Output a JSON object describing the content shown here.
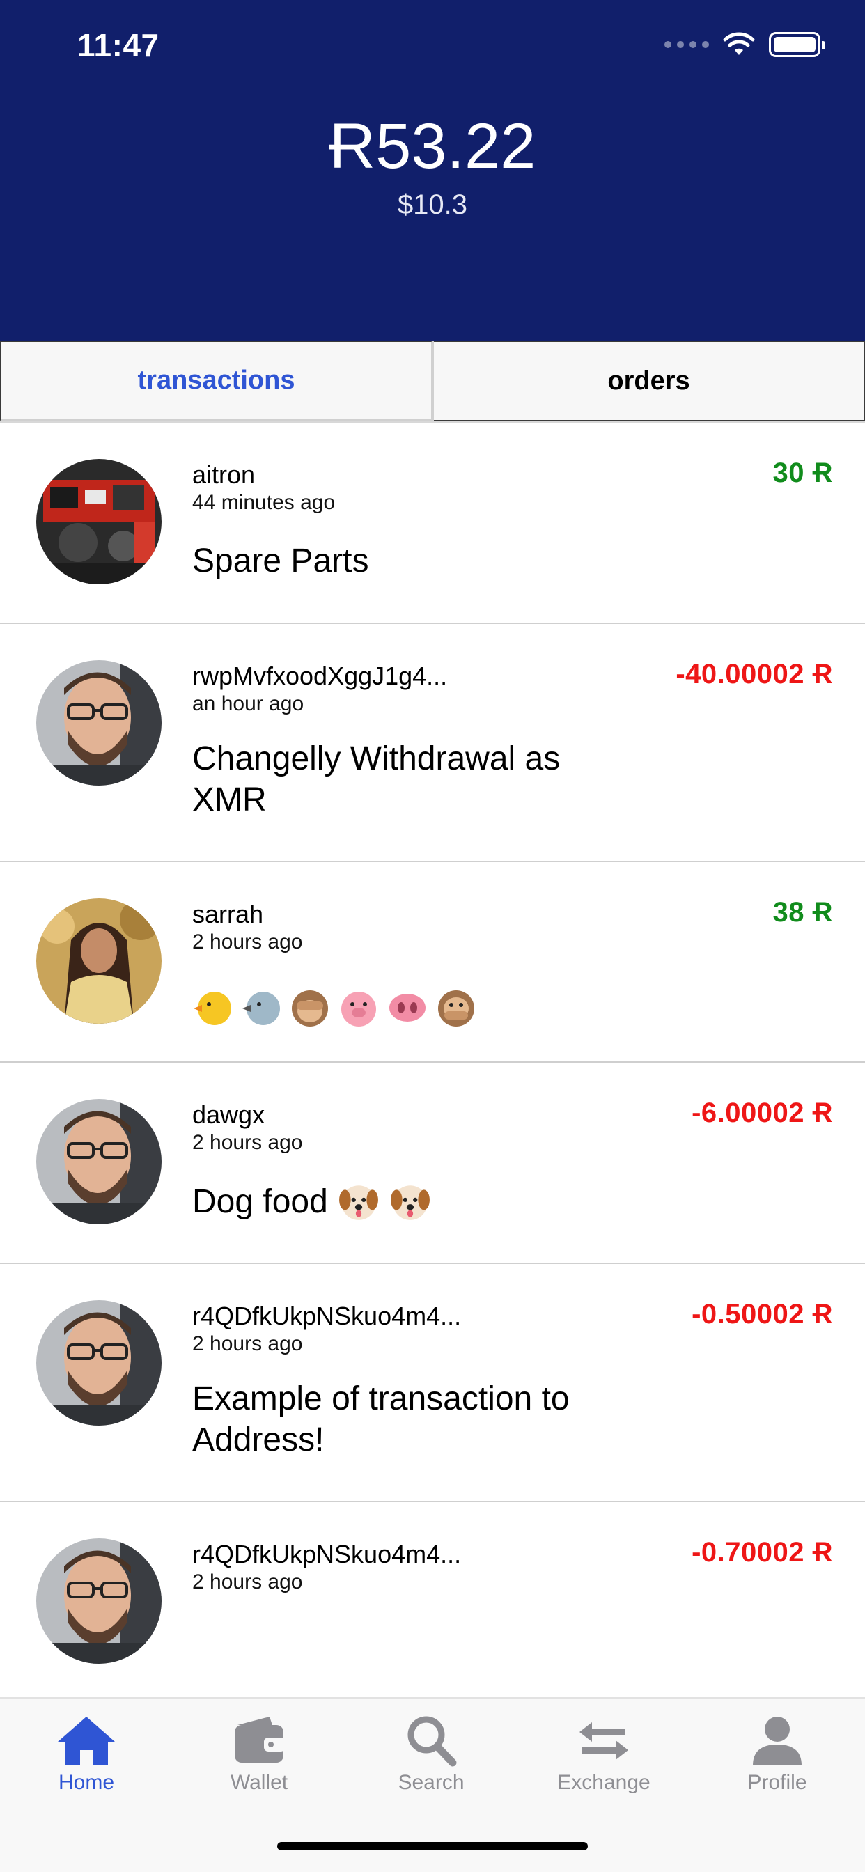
{
  "status_bar": {
    "time": "11:47"
  },
  "header": {
    "balance": "Ɍ53.22",
    "balance_usd": "$10.3"
  },
  "tabs": [
    {
      "label": "transactions",
      "active": true
    },
    {
      "label": "orders",
      "active": false
    }
  ],
  "transactions": [
    {
      "name": "aitron",
      "time": "44 minutes ago",
      "amount": "30 Ɍ",
      "direction": "positive",
      "memo": "Spare Parts",
      "avatar": "engine-photo"
    },
    {
      "name": "rwpMvfxoodXggJ1g4...",
      "time": "an hour ago",
      "amount": "-40.00002 Ɍ",
      "direction": "negative",
      "memo": "Changelly Withdrawal as XMR",
      "avatar": "man-glasses-photo"
    },
    {
      "name": "sarrah",
      "time": "2 hours ago",
      "amount": "38 Ɍ",
      "direction": "positive",
      "memo": "",
      "memo_emojis": [
        "chick-emoji",
        "bird-emoji",
        "see-no-evil-monkey-emoji",
        "pig-face-emoji",
        "pig-nose-emoji",
        "speak-no-evil-monkey-emoji"
      ],
      "avatar": "woman-photo"
    },
    {
      "name": "dawgx",
      "time": "2 hours ago",
      "amount": "-6.00002 Ɍ",
      "direction": "negative",
      "memo": "Dog food",
      "memo_emojis": [
        "dog-face-emoji",
        "dog-face-emoji"
      ],
      "avatar": "man-glasses-photo"
    },
    {
      "name": "r4QDfkUkpNSkuo4m4...",
      "time": "2 hours ago",
      "amount": "-0.50002 Ɍ",
      "direction": "negative",
      "memo": "Example of transaction to Address!",
      "avatar": "man-glasses-photo"
    },
    {
      "name": "r4QDfkUkpNSkuo4m4...",
      "time": "2 hours ago",
      "amount": "-0.70002 Ɍ",
      "direction": "negative",
      "memo": "",
      "avatar": "man-glasses-photo"
    }
  ],
  "tab_bar": [
    {
      "label": "Home",
      "icon": "home-icon",
      "active": true
    },
    {
      "label": "Wallet",
      "icon": "wallet-icon",
      "active": false
    },
    {
      "label": "Search",
      "icon": "search-icon",
      "active": false
    },
    {
      "label": "Exchange",
      "icon": "exchange-icon",
      "active": false
    },
    {
      "label": "Profile",
      "icon": "profile-icon",
      "active": false
    }
  ],
  "colors": {
    "header_bg": "#111f6b",
    "accent": "#2f55d4",
    "positive": "#118c1c",
    "negative": "#ee1616",
    "tab_inactive": "#8e8e93"
  }
}
